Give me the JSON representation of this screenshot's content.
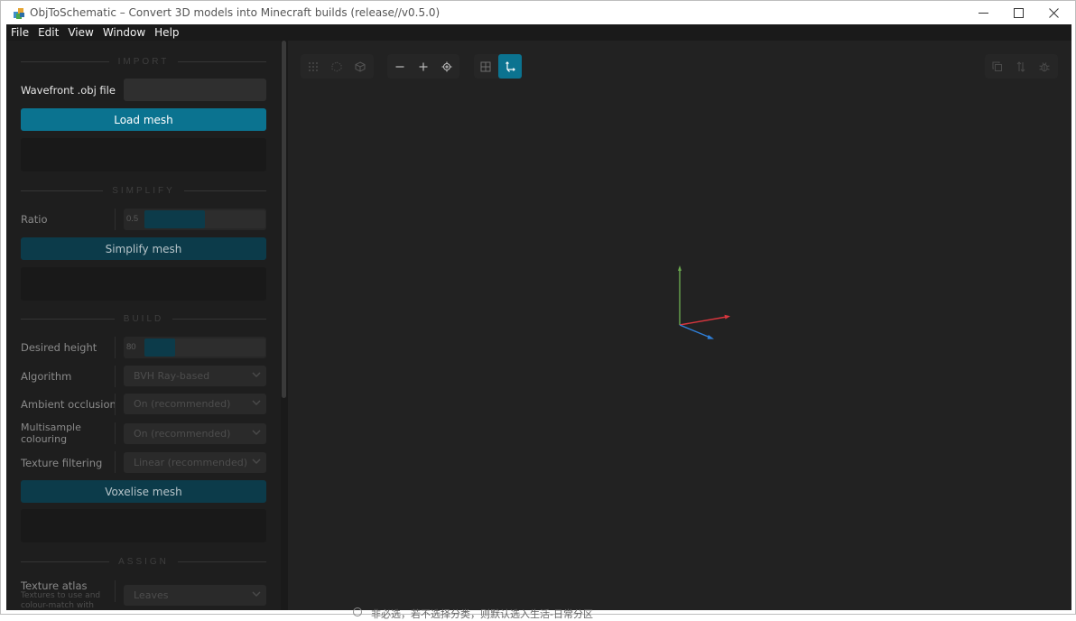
{
  "window": {
    "title": "ObjToSchematic – Convert 3D models into Minecraft builds (release//v0.5.0)",
    "minimize_icon": "minimize-icon",
    "maximize_icon": "maximize-icon",
    "close_icon": "close-icon"
  },
  "menu": [
    "File",
    "Edit",
    "View",
    "Window",
    "Help"
  ],
  "sidebar": {
    "import": {
      "heading": "IMPORT",
      "file_label": "Wavefront .obj file",
      "file_value": "",
      "button": "Load mesh"
    },
    "simplify": {
      "heading": "SIMPLIFY",
      "ratio_label": "Ratio",
      "ratio_value": "0.5",
      "ratio_fraction": 0.5,
      "button": "Simplify mesh"
    },
    "build": {
      "heading": "BUILD",
      "height_label": "Desired height",
      "height_value": "80",
      "height_fraction": 0.25,
      "algorithm_label": "Algorithm",
      "algorithm_value": "BVH Ray-based",
      "ao_label": "Ambient occlusion",
      "ao_value": "On (recommended)",
      "multisample_label": "Multisample colouring",
      "multisample_value": "On (recommended)",
      "texture_filter_label": "Texture filtering",
      "texture_filter_value": "Linear (recommended)",
      "button": "Voxelise mesh"
    },
    "assign": {
      "heading": "ASSIGN",
      "atlas_label": "Texture atlas",
      "atlas_sub": "Textures to use and colour-match with",
      "atlas_value": "Leaves"
    }
  },
  "toolbar": {
    "left_group": [
      "points-icon",
      "wireframe-icon",
      "cube-icon"
    ],
    "zoom_group": [
      "zoom-out-icon",
      "zoom-in-icon",
      "center-target-icon"
    ],
    "view_group": [
      "grid-icon",
      "axes-icon"
    ],
    "right_group": [
      "copy-icon",
      "sort-icon",
      "bug-icon"
    ],
    "active": "axes-icon"
  },
  "bleed_text": "非必选，若不选择分类，则默认选入生活-日常分区",
  "colors": {
    "accent": "#0b7390",
    "accent_muted": "#0c3b4a",
    "axis_x": "#d9363e",
    "axis_y": "#6aa84f",
    "axis_z": "#2f7fd8"
  }
}
